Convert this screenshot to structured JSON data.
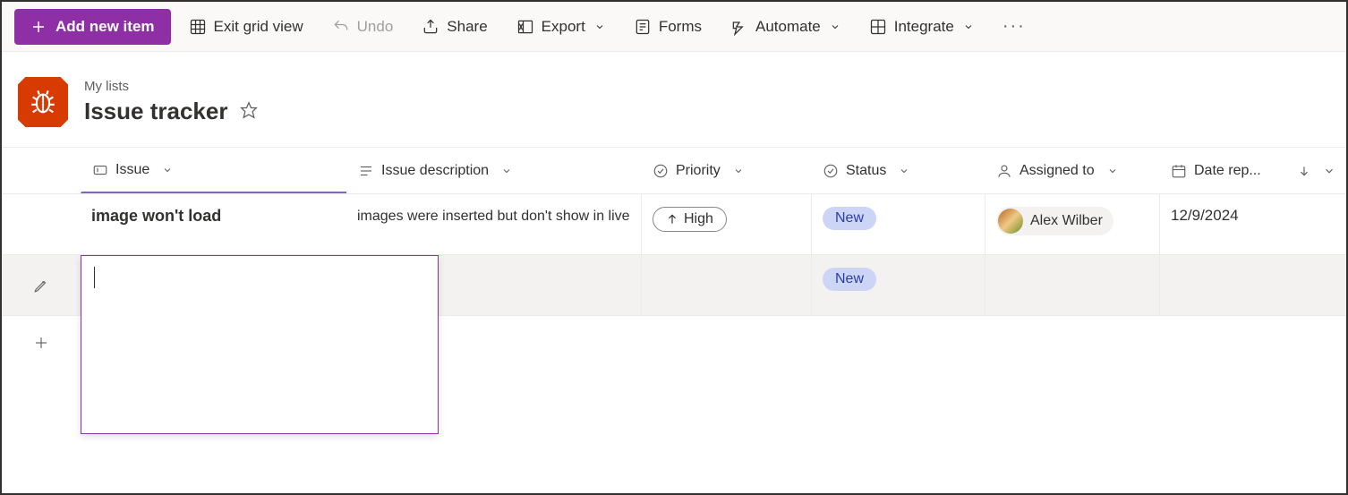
{
  "toolbar": {
    "addNew": "Add new item",
    "exitGrid": "Exit grid view",
    "undo": "Undo",
    "share": "Share",
    "export": "Export",
    "forms": "Forms",
    "automate": "Automate",
    "integrate": "Integrate"
  },
  "breadcrumb": "My lists",
  "listTitle": "Issue tracker",
  "columns": {
    "issue": "Issue",
    "desc": "Issue description",
    "priority": "Priority",
    "status": "Status",
    "assigned": "Assigned to",
    "date": "Date rep..."
  },
  "rows": [
    {
      "issue": "image won't load",
      "desc": "images were inserted but don't show in live",
      "priority": "High",
      "status": "New",
      "assigned": "Alex Wilber",
      "date": "12/9/2024"
    },
    {
      "issue": "",
      "desc": "",
      "priority": "",
      "status": "New",
      "assigned": "",
      "date": ""
    }
  ]
}
